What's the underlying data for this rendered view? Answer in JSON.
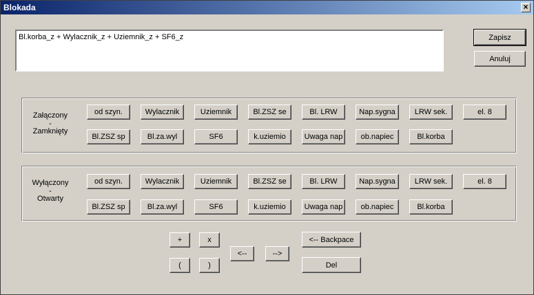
{
  "window": {
    "title": "Blokada"
  },
  "expression": "Bl.korba_z + Wylacznik_z + Uziemnik_z + SF6_z",
  "actions": {
    "save": "Zapisz",
    "cancel": "Anuluj"
  },
  "groups": [
    {
      "label1": "Załączony",
      "sep": "-",
      "label2": "Zamknięty",
      "row1": [
        "od szyn.",
        "Wylacznik",
        "Uziemnik",
        "Bl.ZSZ se",
        "Bl. LRW",
        "Nap.sygna",
        "LRW sek.",
        "el. 8"
      ],
      "row2": [
        "Bl.ZSZ sp",
        "Bl.za.wyl",
        "SF6",
        "k.uziemio",
        "Uwaga nap",
        "ob.napiec",
        "Bl.korba"
      ]
    },
    {
      "label1": "Wyłączony",
      "sep": "-",
      "label2": "Otwarty",
      "row1": [
        "od szyn.",
        "Wylacznik",
        "Uziemnik",
        "Bl.ZSZ se",
        "Bl. LRW",
        "Nap.sygna",
        "LRW sek.",
        "el. 8"
      ],
      "row2": [
        "Bl.ZSZ sp",
        "Bl.za.wyl",
        "SF6",
        "k.uziemio",
        "Uwaga nap",
        "ob.napiec",
        "Bl.korba"
      ]
    }
  ],
  "operators": {
    "plus": "+",
    "times": "x",
    "lparen": "(",
    "rparen": ")",
    "left": "<--",
    "right": "-->",
    "backspace": "<-- Backpace",
    "del": "Del"
  }
}
